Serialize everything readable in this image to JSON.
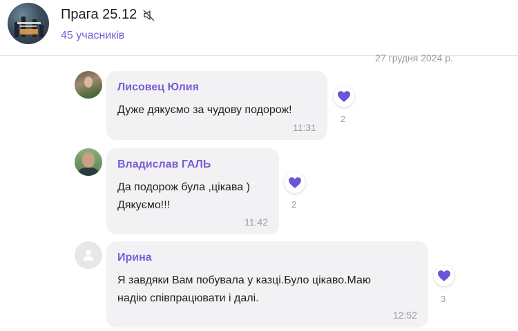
{
  "header": {
    "title": "Прага 25.12",
    "members": "45 учасників",
    "mute_icon": "muted-speaker-icon"
  },
  "date_separator": "27 грудня 2024 р.",
  "messages": [
    {
      "sender": "Лисовец Юлия",
      "lines": [
        "Дуже дякуємо за чудову подорож!"
      ],
      "time": "11:31",
      "reaction": {
        "icon": "heart-icon",
        "count": "2"
      }
    },
    {
      "sender": "Владислав ГАЛЬ",
      "lines": [
        "Да подорож була ,цікава )",
        "Дякуємо!!!"
      ],
      "time": "11:42",
      "reaction": {
        "icon": "heart-icon",
        "count": "2"
      }
    },
    {
      "sender": "Ирина",
      "lines": [
        "Я завдяки Вам побувала у казці.Було цікаво.Маю",
        "надію співпрацювати і далі."
      ],
      "time": "12:52",
      "reaction": {
        "icon": "heart-icon",
        "count": "3"
      }
    }
  ],
  "colors": {
    "accent": "#7b5cd6",
    "bubble": "#f2f2f4",
    "heart": "#6a54d8",
    "muted_text": "#9a9aa0"
  }
}
